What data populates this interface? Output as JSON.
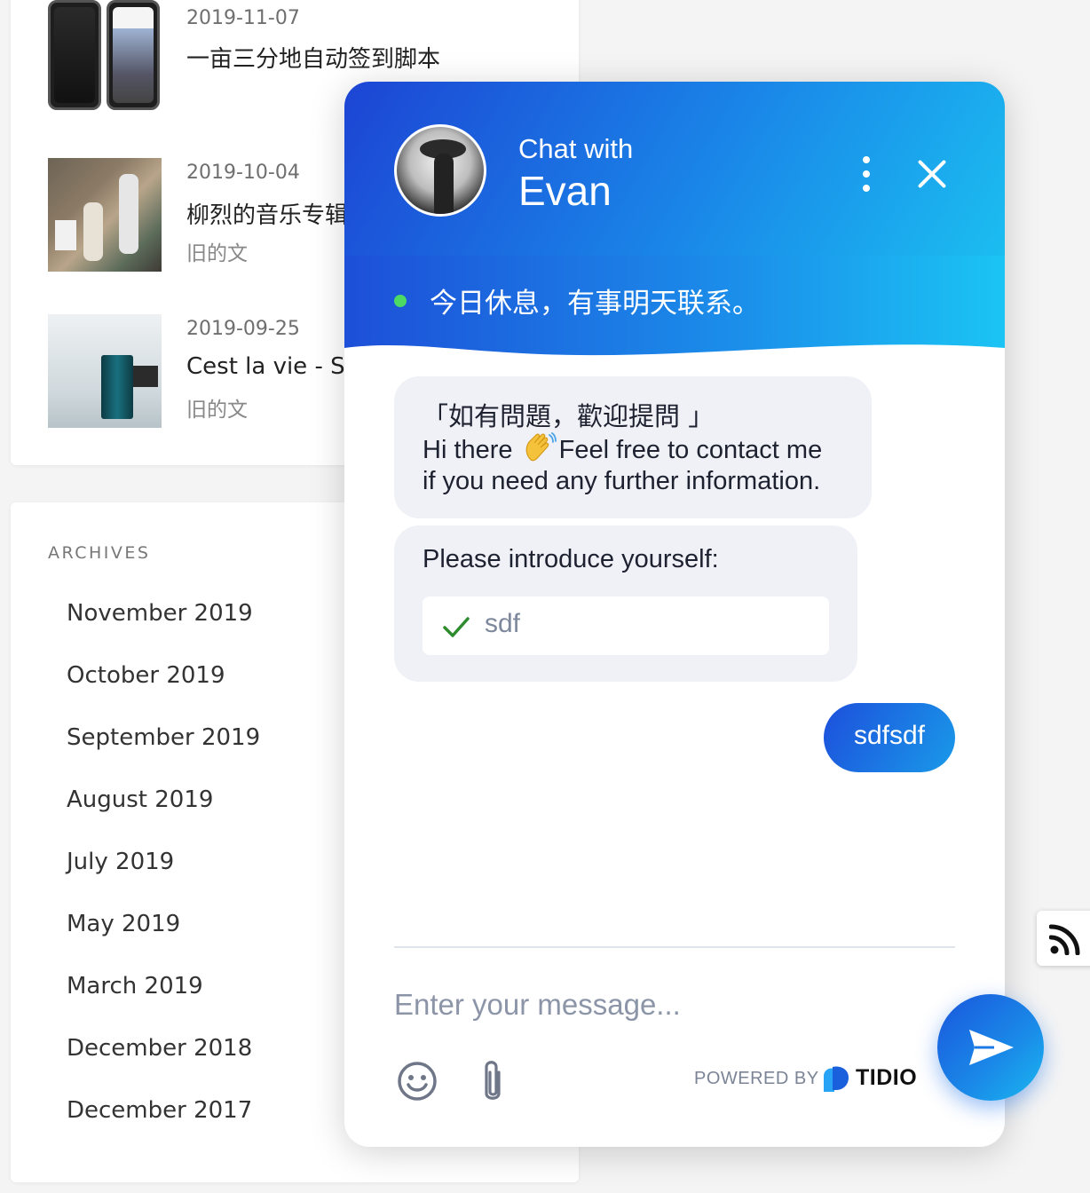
{
  "posts": [
    {
      "date": "2019-11-07",
      "title": "一亩三分地自动签到脚本",
      "tag": ""
    },
    {
      "date": "2019-10-04",
      "title": "柳烈的音乐专辑",
      "tag": "旧的文"
    },
    {
      "date": "2019-09-25",
      "title": "Cest la vie - Se",
      "tag": "旧的文"
    }
  ],
  "archives": {
    "heading": "ARCHIVES",
    "links": [
      "November 2019",
      "October 2019",
      "September 2019",
      "August 2019",
      "July 2019",
      "May 2019",
      "March 2019",
      "December 2018",
      "December 2017"
    ]
  },
  "chat": {
    "header": {
      "subtitle": "Chat with",
      "agent_name": "Evan"
    },
    "status": {
      "text": "今日休息，有事明天联系。",
      "dot_color": "#4cd964"
    },
    "messages": {
      "greeting_line1": "「如有問題，歡迎提問 」",
      "greeting_line2_a": "Hi there",
      "greeting_line2_b": "Feel free to contact me",
      "greeting_line3": "if you need any further information.",
      "form_question": "Please introduce yourself:",
      "form_answer": "sdf",
      "visitor_message": "sdfsdf"
    },
    "input": {
      "placeholder": "Enter your message..."
    },
    "footer": {
      "powered_by": "POWERED BY",
      "brand": "TIDIO"
    },
    "icons": [
      "menu-icon",
      "close-icon",
      "emoji-icon",
      "paperclip-icon",
      "send-icon",
      "check-icon",
      "rss-icon"
    ],
    "accent_color": "#1a86e8"
  }
}
